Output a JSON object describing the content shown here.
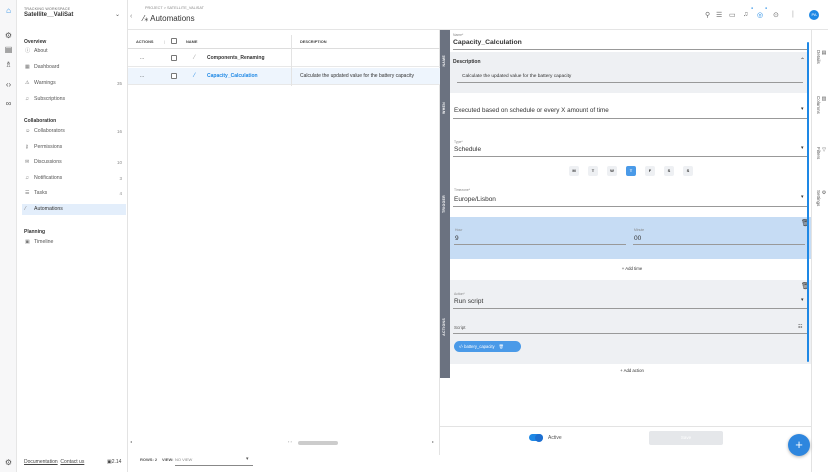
{
  "workspace": {
    "label": "TRACKING WORKSPACE",
    "name": "Satellite__ValiSat"
  },
  "sidebar": {
    "overview_title": "Overview",
    "overview": [
      {
        "label": "About",
        "icon": "info"
      },
      {
        "label": "Dashboard",
        "icon": "dashboard"
      },
      {
        "label": "Warnings",
        "icon": "warning",
        "count": "35"
      },
      {
        "label": "Subscriptions",
        "icon": "bell"
      }
    ],
    "collab_title": "Collaboration",
    "collab": [
      {
        "label": "Collaborators",
        "icon": "people",
        "count": "16"
      },
      {
        "label": "Permissions",
        "icon": "key"
      },
      {
        "label": "Discussions",
        "icon": "chat",
        "count": "10"
      },
      {
        "label": "Notifications",
        "icon": "bell",
        "count": "3"
      },
      {
        "label": "Tasks",
        "icon": "list",
        "count": "4"
      },
      {
        "label": "Automations",
        "icon": "wand"
      }
    ],
    "planning_title": "Planning",
    "planning": [
      {
        "label": "Timeline",
        "icon": "calendar"
      }
    ],
    "footer": {
      "docs": "Documentation",
      "contact": "Contact us",
      "version": "2.14"
    }
  },
  "header": {
    "breadcrumb": "PROJECT > SATELLITE_VALISAT",
    "title": "Automations"
  },
  "table": {
    "columns": {
      "actions": "ACTIONS",
      "name": "NAME",
      "description": "DESCRIPTION"
    },
    "rows": [
      {
        "actions": "...",
        "name": "Components_Renaming",
        "description": ""
      },
      {
        "actions": "...",
        "name": "Capacity_Calculation",
        "description": "Calculate the updated value for the battery capacity"
      }
    ],
    "footer": {
      "rows_label": "ROWS: 2",
      "view_label": "VIEW:",
      "view_value": "NO VIEW"
    }
  },
  "panel": {
    "strips": {
      "name": "NAME",
      "when": "WHEN",
      "trigger": "TRIGGER",
      "actions": "ACTIONS"
    },
    "name_label": "Name*",
    "name_value": "Capacity_Calculation",
    "desc_label": "Description",
    "desc_value": "Calculate the updated value for the battery capacity",
    "when_value": "Executed based on schedule or every X amount of time",
    "type_label": "Type*",
    "type_value": "Schedule",
    "days": [
      {
        "d": "M",
        "on": false
      },
      {
        "d": "T",
        "on": false
      },
      {
        "d": "W",
        "on": false
      },
      {
        "d": "T",
        "on": true
      },
      {
        "d": "F",
        "on": false
      },
      {
        "d": "S",
        "on": false
      },
      {
        "d": "S",
        "on": false
      }
    ],
    "tz_label": "Timezone*",
    "tz_value": "Europe/Lisbon",
    "hour_label": "Hour",
    "hour_value": "9",
    "minute_label": "Minute",
    "minute_value": "00",
    "add_time": "+ Add time",
    "action_label": "Action*",
    "action_value": "Run script",
    "script_label": "Script",
    "script_chip": "battery_capacity",
    "add_action": "+ Add action",
    "active_label": "Active",
    "save_label": "Save"
  },
  "right_tabs": [
    {
      "label": "Details",
      "icon": "doc"
    },
    {
      "label": "Columns",
      "icon": "cols"
    },
    {
      "label": "Filters",
      "icon": "filter"
    },
    {
      "label": "Settings",
      "icon": "gear"
    }
  ],
  "colors": {
    "accent": "#1e88e5",
    "strip": "#6b7280",
    "highlight": "#c6dcf4",
    "soft": "#e3eefb"
  }
}
